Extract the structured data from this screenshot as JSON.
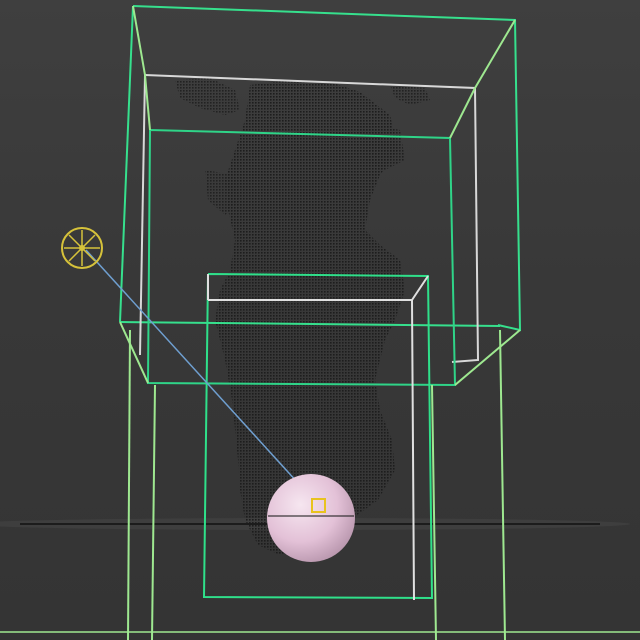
{
  "viewport": {
    "name": "3d-perspective-viewport",
    "background_color": "#3a3a3a"
  },
  "colors": {
    "bounding_box_bright": "#2fe08a",
    "bounding_box_light": "#9ee890",
    "bounding_box_white": "#e6e6e6",
    "point_cloud": "#1e1e1e",
    "sphere_fill": "#e9c9df",
    "light_gizmo": "#d6c23a",
    "target_line": "#6f9fd0",
    "ground_line": "#1c1c1c"
  },
  "objects": {
    "point_cloud": {
      "icon": "point-cloud-object"
    },
    "sphere": {
      "icon": "sphere-object"
    },
    "light": {
      "icon": "omni-light-icon"
    },
    "light_target": {
      "icon": "target-square-icon"
    },
    "bounding_box_upper": {
      "icon": "wireframe-box"
    },
    "bounding_box_lower": {
      "icon": "wireframe-box"
    }
  }
}
